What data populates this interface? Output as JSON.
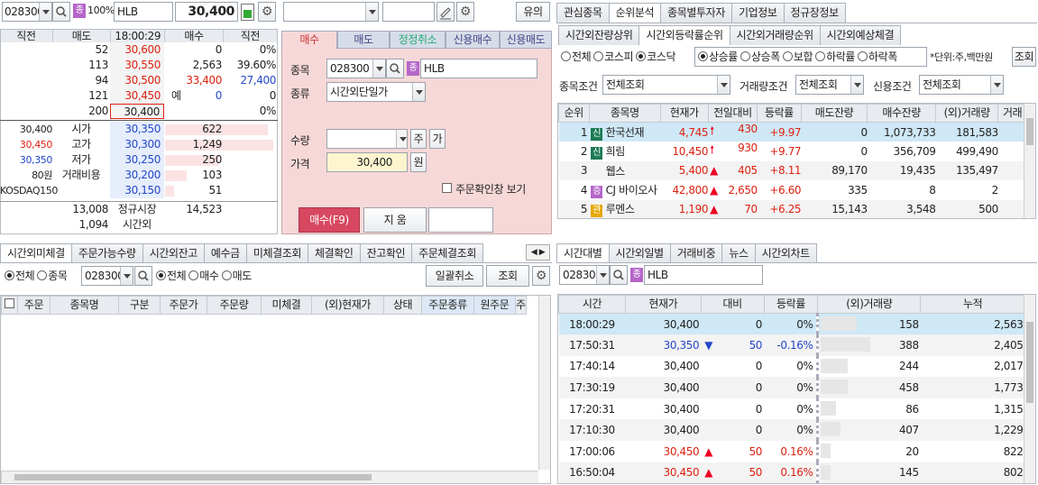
{
  "left": {
    "code": "028300",
    "jong": "종",
    "ratio": "100%",
    "name": "HLB",
    "price": "30,400",
    "ob_headers": [
      "직전",
      "매도",
      "18:00:29",
      "매수",
      "직전"
    ],
    "ask": [
      {
        "q": "52",
        "p": "30,600",
        "bq": "0",
        "pct": "0%"
      },
      {
        "q": "113",
        "p": "30,550",
        "bq": "2,563",
        "pct": "39.60%"
      },
      {
        "q": "94",
        "p": "30,500",
        "bq": "33,400",
        "pct": "27,400"
      },
      {
        "q": "121",
        "p": "30,450",
        "bq": "0",
        "pct": "0",
        "ye": "예"
      },
      {
        "q": "200",
        "p": "30,400",
        "bq": "",
        "pct": "0%"
      }
    ],
    "info": [
      {
        "a": "30,400",
        "lbl": "시가",
        "p": "30,350",
        "q": "622"
      },
      {
        "a": "30,450",
        "lbl": "고가",
        "p": "30,300",
        "q": "1,249"
      },
      {
        "a": "30,350",
        "lbl": "저가",
        "p": "30,250",
        "q": "250"
      },
      {
        "a": "80원",
        "lbl": "거래비용",
        "p": "30,200",
        "q": "103"
      },
      {
        "a": "KOSDAQ150",
        "lbl": "",
        "p": "30,150",
        "q": "51"
      }
    ],
    "tot_sell": "13,008",
    "tot_lbl": "정규시장",
    "tot_buy": "14,523",
    "ah_q": "1,094",
    "ah_lbl": "시간외"
  },
  "order": {
    "warn_btn": "유의",
    "tabs": [
      "매수",
      "매도",
      "정정취소",
      "신용매수",
      "신용매도"
    ],
    "code_lbl": "종목",
    "code": "028300",
    "jong": "종",
    "name": "HLB",
    "type_lbl": "종류",
    "type": "시간외단일가",
    "qty_lbl": "수량",
    "qty_btn1": "주",
    "qty_btn2": "가",
    "price_lbl": "가격",
    "price": "30,400",
    "won": "원",
    "confirm": "주문확인창 보기",
    "buy_btn": "매수(F9)",
    "clear_btn": "지  움"
  },
  "right": {
    "tabs": [
      "관심종목",
      "순위분석",
      "종목별투자자",
      "기업정보",
      "정규장정보"
    ],
    "subtabs": [
      "시간외잔량상위",
      "시간외등락률순위",
      "시간외거래량순위",
      "시간외예상체결"
    ],
    "market": [
      "전체",
      "코스피",
      "코스닥"
    ],
    "sort": [
      "상승률",
      "상승폭",
      "보합",
      "하락률",
      "하락폭"
    ],
    "unit": "*단위:주,백만원",
    "search": "조회",
    "cond1_lbl": "종목조건",
    "cond1": "전체조회",
    "cond2_lbl": "거래량조건",
    "cond2": "전체조회",
    "cond3_lbl": "신용조건",
    "cond3": "전체조회",
    "headers": [
      "순위",
      "종목명",
      "현재가",
      "전일대비",
      "등락률",
      "매도잔량",
      "매수잔량",
      "(외)거래량",
      "거래"
    ],
    "rows": [
      {
        "rank": "1",
        "badge": "신",
        "name": "한국선재",
        "price": "4,745",
        "chg": "430",
        "rate": "+9.97",
        "sell": "0",
        "buy": "1,073,733",
        "vol": "181,583"
      },
      {
        "rank": "2",
        "badge": "신",
        "name": "희림",
        "price": "10,450",
        "chg": "930",
        "rate": "+9.77",
        "sell": "0",
        "buy": "356,709",
        "vol": "499,490"
      },
      {
        "rank": "3",
        "badge": "",
        "name": "웹스",
        "price": "5,400",
        "chg": "405",
        "rate": "+8.11",
        "sell": "89,170",
        "buy": "19,435",
        "vol": "135,497"
      },
      {
        "rank": "4",
        "badge": "증",
        "name": "CJ 바이오사",
        "price": "42,800",
        "chg": "2,650",
        "rate": "+6.60",
        "sell": "335",
        "buy": "8",
        "vol": "2"
      },
      {
        "rank": "5",
        "badge": "관",
        "name": "루멘스",
        "price": "1,190",
        "chg": "70",
        "rate": "+6.25",
        "sell": "15,143",
        "buy": "3,548",
        "vol": "500"
      }
    ]
  },
  "bl": {
    "tabs": [
      "시간외미체결",
      "주문가능수량",
      "시간외잔고",
      "예수금",
      "미체결조회",
      "체결확인",
      "잔고확인",
      "주문체결조회"
    ],
    "opt1": [
      "전체",
      "종목"
    ],
    "code": "028300",
    "opt2": [
      "전체",
      "매수",
      "매도"
    ],
    "bulk_cancel": "일괄취소",
    "search": "조회",
    "headers": [
      "주문",
      "종목명",
      "구분",
      "주문가",
      "주문량",
      "미체결",
      "(외)현재가",
      "상태",
      "주문종류",
      "원주문",
      "주"
    ]
  },
  "br": {
    "tabs": [
      "시간대별",
      "시간외일별",
      "거래비중",
      "뉴스",
      "시간외차트"
    ],
    "code": "028300",
    "jong": "종",
    "name": "HLB",
    "headers": [
      "시간",
      "현재가",
      "대비",
      "등락률",
      "(외)거래량",
      "누적"
    ],
    "rows": [
      {
        "t": "18:00:29",
        "p": "30,400",
        "d": "0",
        "r": "0%",
        "v": "158",
        "c": "2,563",
        "dir": "",
        "bar": 0.72
      },
      {
        "t": "17:50:31",
        "p": "30,350",
        "d": "50",
        "r": "-0.16%",
        "v": "388",
        "c": "2,405",
        "dir": "down",
        "bar": 1.0
      },
      {
        "t": "17:40:14",
        "p": "30,400",
        "d": "0",
        "r": "0%",
        "v": "244",
        "c": "2,017",
        "dir": "",
        "bar": 0.55
      },
      {
        "t": "17:30:19",
        "p": "30,400",
        "d": "0",
        "r": "0%",
        "v": "458",
        "c": "1,773",
        "dir": "",
        "bar": 0.55
      },
      {
        "t": "17:20:31",
        "p": "30,400",
        "d": "0",
        "r": "0%",
        "v": "86",
        "c": "1,315",
        "dir": "",
        "bar": 0.3
      },
      {
        "t": "17:10:30",
        "p": "30,400",
        "d": "0",
        "r": "0%",
        "v": "407",
        "c": "1,229",
        "dir": "",
        "bar": 0.4
      },
      {
        "t": "17:00:06",
        "p": "30,450",
        "d": "50",
        "r": "0.16%",
        "v": "20",
        "c": "822",
        "dir": "up",
        "bar": 0.2
      },
      {
        "t": "16:50:04",
        "p": "30,450",
        "d": "50",
        "r": "0.16%",
        "v": "145",
        "c": "802",
        "dir": "up",
        "bar": 0.2
      }
    ]
  }
}
